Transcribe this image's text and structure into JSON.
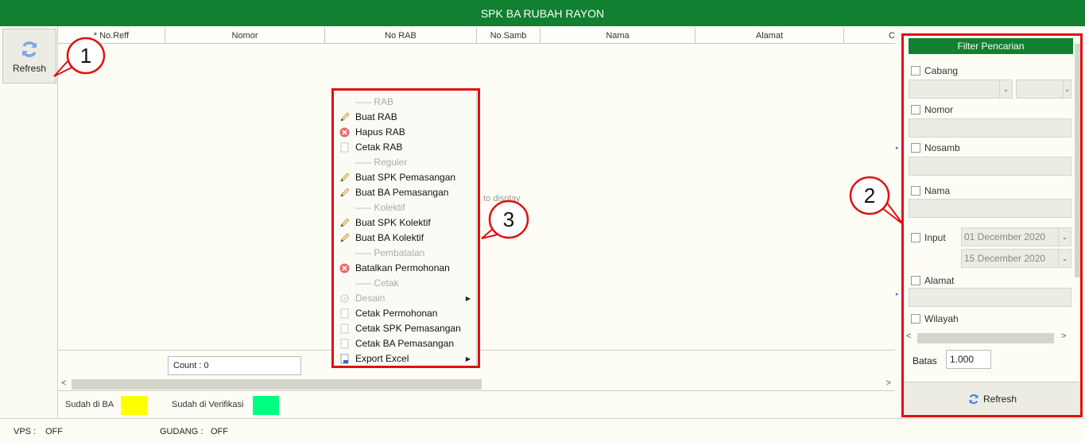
{
  "window": {
    "title": "SPK BA RUBAH RAYON"
  },
  "toolbar": {
    "refresh_label": "Refresh"
  },
  "grid": {
    "columns": [
      "* No.Reff",
      "Nomor",
      "No RAB",
      "No.Samb",
      "Nama",
      "Alamat",
      "C"
    ],
    "empty_text": "to display",
    "count_label": "Count : 0"
  },
  "legend": {
    "sudah_ba_label": "Sudah di BA",
    "sudah_ba_color": "#ffff00",
    "sudah_verifikasi_label": "Sudah di Verifikasi",
    "sudah_verifikasi_color": "#00ff80"
  },
  "filter": {
    "title": "Filter Pencarian",
    "cabang_label": "Cabang",
    "nomor_label": "Nomor",
    "nosamb_label": "Nosamb",
    "nama_label": "Nama",
    "input_label": "Input",
    "date_from": "01 December 2020",
    "date_to": "15 December 2020",
    "alamat_label": "Alamat",
    "wilayah_label": "Wilayah",
    "batas_label": "Batas",
    "batas_value": "1.000",
    "refresh_label": "Refresh"
  },
  "status": {
    "vps_label": "VPS :",
    "vps_value": "OFF",
    "gudang_label": "GUDANG :",
    "gudang_value": "OFF"
  },
  "context_menu": {
    "items": [
      {
        "label": "----- RAB",
        "kind": "header"
      },
      {
        "label": "Buat RAB",
        "icon": "pencil-icon"
      },
      {
        "label": "Hapus RAB",
        "icon": "delete-icon"
      },
      {
        "label": "Cetak RAB",
        "icon": "document-icon"
      },
      {
        "label": "----- Reguler",
        "kind": "header"
      },
      {
        "label": "Buat SPK Pemasangan",
        "icon": "pencil-icon"
      },
      {
        "label": "Buat BA Pemasangan",
        "icon": "pencil-icon"
      },
      {
        "label": "----- Kolektif",
        "kind": "header"
      },
      {
        "label": "Buat SPK Kolektif",
        "icon": "pencil-icon"
      },
      {
        "label": "Buat BA Kolektif",
        "icon": "pencil-icon"
      },
      {
        "label": "----- Pembatalan",
        "kind": "header"
      },
      {
        "label": "Batalkan Permohonan",
        "icon": "delete-icon"
      },
      {
        "label": "----- Cetak",
        "kind": "header"
      },
      {
        "label": "Desain",
        "icon": "gear-icon",
        "disabled": true,
        "submenu": true
      },
      {
        "label": "Cetak Permohonan",
        "icon": "document-icon"
      },
      {
        "label": "Cetak SPK Pemasangan",
        "icon": "document-icon"
      },
      {
        "label": "Cetak BA Pemasangan",
        "icon": "document-icon"
      },
      {
        "label": "Export Excel",
        "icon": "excel-icon",
        "submenu": true
      }
    ]
  },
  "callouts": [
    "1",
    "2",
    "3"
  ],
  "colors": {
    "accent": "#118030",
    "highlight": "#e01010"
  }
}
